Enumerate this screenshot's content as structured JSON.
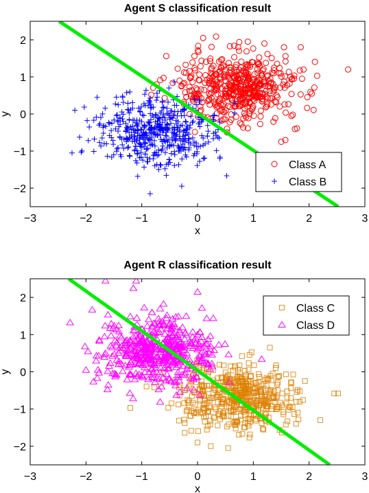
{
  "chart_data": [
    {
      "type": "scatter",
      "title": "Agent S classification result",
      "xlabel": "x",
      "ylabel": "y",
      "xlim": [
        -3,
        3
      ],
      "ylim": [
        -2.5,
        2.5
      ],
      "xticks": [
        -3,
        -2,
        -1,
        0,
        1,
        2,
        3
      ],
      "yticks": [
        -2,
        -1,
        0,
        1,
        2
      ],
      "xtick_labels": [
        "−3",
        "−2",
        "−1",
        "0",
        "1",
        "2",
        "3"
      ],
      "ytick_labels": [
        "−2",
        "−1",
        "0",
        "1",
        "2"
      ],
      "grid": false,
      "legend_position": "bottom-right",
      "decision_boundary": {
        "color": "#00ee00",
        "points": [
          [
            -2.48,
            2.5
          ],
          [
            2.52,
            -2.5
          ]
        ]
      },
      "series": [
        {
          "name": "Class A",
          "marker": "circle",
          "color": "#ff0000",
          "count": 500,
          "mean": [
            0.7,
            0.7
          ],
          "std": [
            0.5,
            0.45
          ],
          "seed": 11,
          "outliers": [
            [
              2.7,
              1.2
            ],
            [
              0.1,
              2.05
            ],
            [
              1.2,
              1.9
            ],
            [
              1.55,
              1.8
            ],
            [
              1.5,
              -0.75
            ],
            [
              1.85,
              1.8
            ],
            [
              2.05,
              0.55
            ]
          ]
        },
        {
          "name": "Class B",
          "marker": "plus",
          "color": "#0000ff",
          "count": 500,
          "mean": [
            -0.7,
            -0.5
          ],
          "std": [
            0.5,
            0.45
          ],
          "seed": 23,
          "outliers": [
            [
              -2.25,
              -1.05
            ],
            [
              -2.2,
              0.1
            ],
            [
              -1.8,
              0.45
            ],
            [
              -0.85,
              -2.15
            ],
            [
              0.4,
              -1.2
            ]
          ]
        }
      ]
    },
    {
      "type": "scatter",
      "title": "Agent R classification result",
      "xlabel": "x",
      "ylabel": "y",
      "xlim": [
        -3,
        3
      ],
      "ylim": [
        -2.5,
        2.5
      ],
      "xticks": [
        -3,
        -2,
        -1,
        0,
        1,
        2,
        3
      ],
      "yticks": [
        -2,
        -1,
        0,
        1,
        2
      ],
      "xtick_labels": [
        "−3",
        "−2",
        "−1",
        "0",
        "1",
        "2",
        "3"
      ],
      "ytick_labels": [
        "−2",
        "−1",
        "0",
        "1",
        "2"
      ],
      "grid": false,
      "legend_position": "top-right",
      "decision_boundary": {
        "color": "#00ee00",
        "points": [
          [
            -2.31,
            2.5
          ],
          [
            2.37,
            -2.5
          ]
        ]
      },
      "series": [
        {
          "name": "Class C",
          "marker": "square",
          "color": "#dd8000",
          "count": 500,
          "mean": [
            0.7,
            -0.7
          ],
          "std": [
            0.5,
            0.45
          ],
          "seed": 37,
          "outliers": [
            [
              2.45,
              -0.58
            ],
            [
              2.52,
              -0.58
            ],
            [
              2.2,
              -1.3
            ],
            [
              1.4,
              0.1
            ],
            [
              0.0,
              -1.9
            ],
            [
              0.55,
              -2.05
            ]
          ]
        },
        {
          "name": "Class D",
          "marker": "triangle",
          "color": "#ff00ff",
          "count": 500,
          "mean": [
            -0.7,
            0.6
          ],
          "std": [
            0.5,
            0.45
          ],
          "seed": 53,
          "outliers": [
            [
              -1.65,
              2.45
            ],
            [
              -1.1,
              2.45
            ],
            [
              -1.15,
              2.25
            ],
            [
              0.0,
              2.15
            ],
            [
              -2.0,
              0.05
            ],
            [
              -1.6,
              -0.35
            ]
          ]
        }
      ]
    }
  ]
}
